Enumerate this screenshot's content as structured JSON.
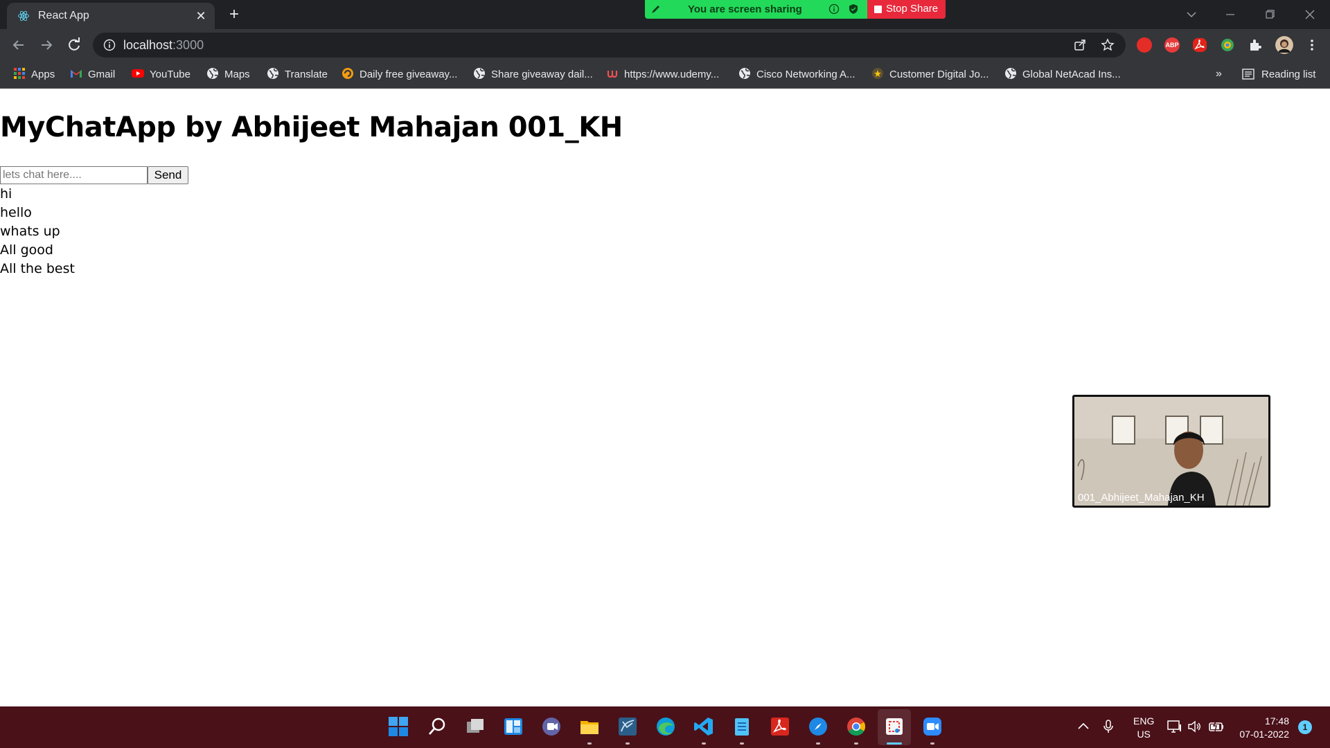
{
  "browser": {
    "tab_title": "React App",
    "tab_close": "✕",
    "new_tab": "+",
    "url_host": "localhost",
    "url_port": ":3000"
  },
  "screen_share": {
    "status_text": "You are screen sharing",
    "stop_label": "Stop Share",
    "bar_color": "#23d959",
    "stop_color": "#e8283b"
  },
  "bookmarks": {
    "items": [
      {
        "label": "Apps",
        "icon": "apps-grid-icon"
      },
      {
        "label": "Gmail",
        "icon": "gmail-icon"
      },
      {
        "label": "YouTube",
        "icon": "youtube-icon"
      },
      {
        "label": "Maps",
        "icon": "globe-icon"
      },
      {
        "label": "Translate",
        "icon": "globe-icon"
      },
      {
        "label": "Daily free giveaway...",
        "icon": "giveaway-icon"
      },
      {
        "label": "Share giveaway dail...",
        "icon": "globe-icon"
      },
      {
        "label": "https://www.udemy...",
        "icon": "udemy-icon"
      },
      {
        "label": "Cisco Networking A...",
        "icon": "globe-icon"
      },
      {
        "label": "Customer Digital Jo...",
        "icon": "customer-icon"
      },
      {
        "label": "Global NetAcad Ins...",
        "icon": "globe-icon"
      }
    ],
    "more": "»",
    "reading_list": "Reading list"
  },
  "page": {
    "title": "MyChatApp by Abhijeet Mahajan 001_KH",
    "input_placeholder": "lets chat here....",
    "send_label": "Send",
    "messages": [
      "hi",
      "hello",
      "whats up",
      "All good",
      "All the best"
    ]
  },
  "video": {
    "participant_name": "001_Abhijeet_Mahajan_KH"
  },
  "taskbar": {
    "language": "ENG",
    "region": "US",
    "time": "17:48",
    "date": "07-01-2022",
    "notification_count": "1"
  }
}
